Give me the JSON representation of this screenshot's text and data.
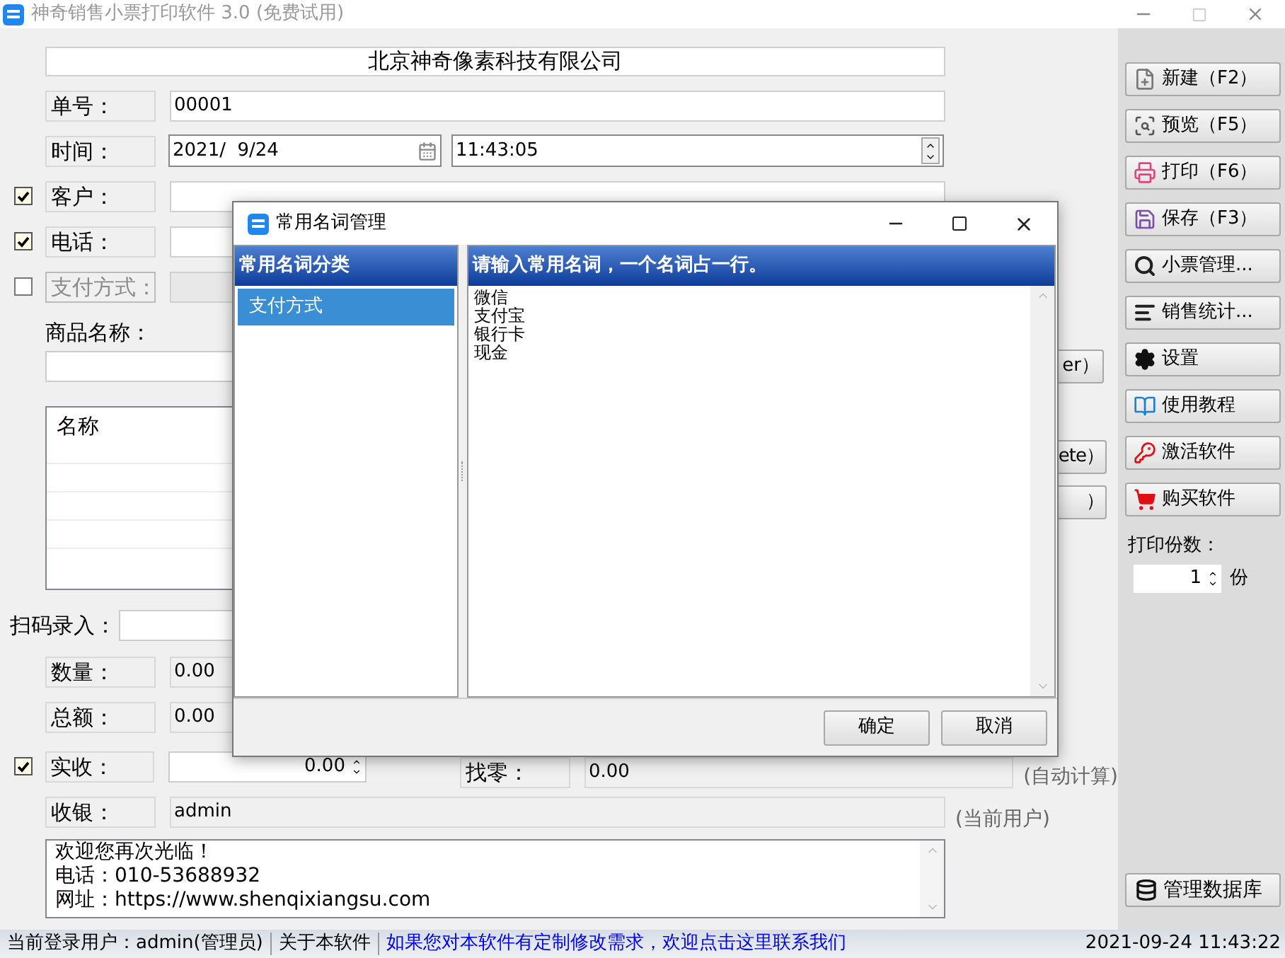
{
  "window": {
    "title": "神奇销售小票打印软件 3.0 (免费试用)"
  },
  "form": {
    "company": "北京神奇像素科技有限公司",
    "order_no": {
      "label": "单号：",
      "value": "00001"
    },
    "time": {
      "label": "时间：",
      "date": "2021/  9/24",
      "time": "11:43:05"
    },
    "customer": {
      "label": "客户：",
      "checked": true
    },
    "phone": {
      "label": "电话：",
      "checked": true
    },
    "payment": {
      "label": "支付方式：",
      "checked": false
    },
    "product": {
      "label": "商品名称：",
      "button": "er）"
    },
    "items_table": {
      "column_1": "名称",
      "buttons": [
        "ete）",
        "）"
      ]
    },
    "scan": {
      "label": "扫码录入："
    },
    "quantity": {
      "label": "数量：",
      "value": "0.00"
    },
    "total": {
      "label": "总额：",
      "value": "0.00"
    },
    "received": {
      "label": "实收：",
      "checked": true,
      "value": "0.00"
    },
    "change": {
      "label": "找零：",
      "value": "0.00",
      "note": "(自动计算)"
    },
    "cashier": {
      "label": "收银：",
      "value": "admin",
      "note": "(当前用户)"
    },
    "footer_text": [
      "欢迎您再次光临！",
      "电话：010-53688932",
      "网址：https://www.shenqixiangsu.com"
    ]
  },
  "side_buttons": [
    {
      "kind": "new",
      "label": "新建（F2）"
    },
    {
      "kind": "preview",
      "label": "预览（F5）"
    },
    {
      "kind": "print",
      "label": "打印（F6）"
    },
    {
      "kind": "save",
      "label": "保存（F3）"
    },
    {
      "kind": "search",
      "label": "小票管理..."
    },
    {
      "kind": "stats",
      "label": "销售统计..."
    },
    {
      "kind": "settings",
      "label": "设置"
    },
    {
      "kind": "guide",
      "label": "使用教程"
    },
    {
      "kind": "activate",
      "label": "激活软件"
    },
    {
      "kind": "buy",
      "label": "购买软件"
    }
  ],
  "print_copies": {
    "label": "打印份数：",
    "value": "1",
    "unit": "份"
  },
  "db_button": "管理数据库",
  "status_bar": {
    "user": "当前登录用户：admin(管理员)",
    "about": "关于本软件",
    "link": "如果您对本软件有定制修改需求，欢迎点击这里联系我们",
    "datetime": "2021-09-24 11:43:22"
  },
  "dialog": {
    "title": "常用名词管理",
    "categories_header": "常用名词分类",
    "categories": [
      {
        "label": "支付方式",
        "selected": true
      }
    ],
    "terms_header": "请输入常用名词，一个名词占一行。",
    "terms": [
      "微信",
      "支付宝",
      "银行卡",
      "现金"
    ],
    "buttons": [
      "确定",
      "取消"
    ]
  }
}
